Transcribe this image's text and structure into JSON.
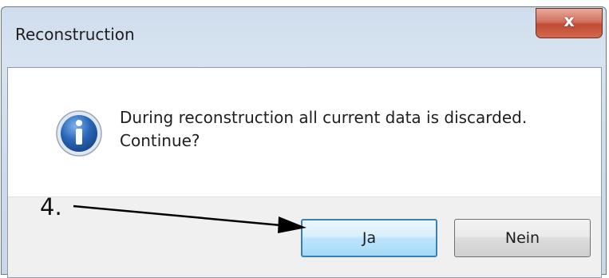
{
  "window": {
    "title": "Reconstruction",
    "close_glyph": "x"
  },
  "dialog": {
    "icon": "info-icon",
    "message_line1": "During reconstruction all current data is discarded.",
    "message_line2": "Continue?"
  },
  "buttons": {
    "yes_label": "Ja",
    "no_label": "Nein"
  },
  "annotation": {
    "step": "4."
  },
  "colors": {
    "default_button_border": "#3c7fb1",
    "info_icon_fill": "#2a66b8",
    "close_button": "#c14a33"
  }
}
